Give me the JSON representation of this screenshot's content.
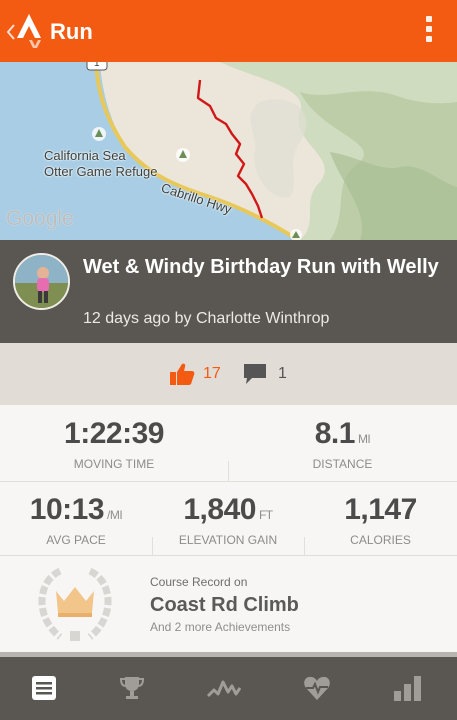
{
  "app_bar": {
    "title": "Run",
    "color": "#f35b12",
    "back_icon": "chevron-left-icon",
    "logo_icon": "strava-logo-icon",
    "menu_icon": "overflow-menu-icon"
  },
  "map": {
    "labels": {
      "refuge": "California Sea\nOtter Game Refuge",
      "highway": "Cabrillo Hwy"
    },
    "highway_shield": "1",
    "attribution": "Google"
  },
  "activity": {
    "title": "Wet & Windy Birthday Run with Welly",
    "subtitle": "12 days ago by Charlotte Winthrop"
  },
  "social": {
    "kudos_count": "17",
    "comments_count": "1",
    "kudos_icon": "thumbs-up-icon",
    "comment_icon": "comment-icon"
  },
  "stats": {
    "moving_time": {
      "value": "1:22:39",
      "unit": "",
      "label": "MOVING TIME"
    },
    "distance": {
      "value": "8.1",
      "unit": "MI",
      "label": "DISTANCE"
    },
    "avg_pace": {
      "value": "10:13",
      "unit": "/MI",
      "label": "AVG PACE"
    },
    "elevation_gain": {
      "value": "1,840",
      "unit": "FT",
      "label": "ELEVATION GAIN"
    },
    "calories": {
      "value": "1,147",
      "unit": "",
      "label": "CALORIES"
    }
  },
  "achievement": {
    "small_label": "Course Record on",
    "segment": "Coast Rd Climb",
    "more": "And 2 more Achievements",
    "icon": "crown-laurel-icon"
  },
  "tabs": [
    {
      "name": "overview",
      "icon": "document-icon",
      "active": true
    },
    {
      "name": "achievements",
      "icon": "trophy-icon",
      "active": false
    },
    {
      "name": "analysis",
      "icon": "pace-chart-icon",
      "active": false
    },
    {
      "name": "heart-rate",
      "icon": "heart-rate-icon",
      "active": false
    },
    {
      "name": "splits",
      "icon": "bar-chart-icon",
      "active": false
    }
  ]
}
